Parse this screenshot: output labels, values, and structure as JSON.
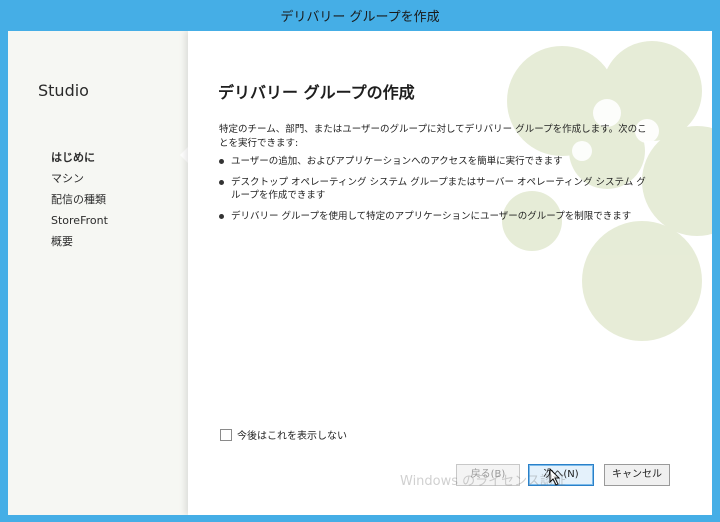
{
  "window": {
    "title": "デリバリー グループを作成"
  },
  "sidebar": {
    "brand": "Studio",
    "items": [
      {
        "label": "はじめに",
        "active": true
      },
      {
        "label": "マシン"
      },
      {
        "label": "配信の種類"
      },
      {
        "label": "StoreFront"
      },
      {
        "label": "概要"
      }
    ]
  },
  "main": {
    "title": "デリバリー グループの作成",
    "intro": "特定のチーム、部門、またはユーザーのグループに対してデリバリー グループを作成します。次のことを実行できます:",
    "bullets": [
      "ユーザーの追加、およびアプリケーションへのアクセスを簡単に実行できます",
      "デスクトップ オペレーティング システム グループまたはサーバー オペレーティング システム グループを作成できます",
      "デリバリー グループを使用して特定のアプリケーションにユーザーのグループを制限できます"
    ],
    "checkbox_label": "今後はこれを表示しない"
  },
  "buttons": {
    "back": "戻る(B)",
    "next": "次へ(N)",
    "cancel": "キャンセル"
  },
  "watermark": "Windows のライセンス認証",
  "colors": {
    "accent": "#45aee6",
    "deco": "#dfe6cc"
  }
}
